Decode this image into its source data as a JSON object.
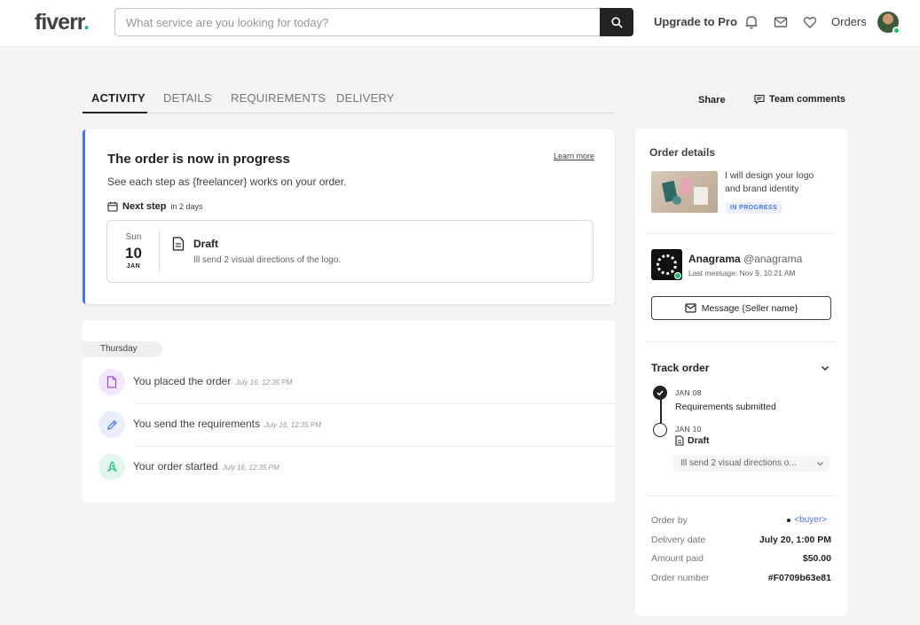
{
  "header": {
    "logo": "fiverr",
    "logo_dot": ".",
    "search_placeholder": "What service are you looking for today?",
    "upgrade_label": "Upgrade to Pro",
    "orders_label": "Orders",
    "icons": [
      "search-icon",
      "bell-icon",
      "mail-icon",
      "heart-icon"
    ]
  },
  "tabs": [
    {
      "label": "ACTIVITY",
      "active": true
    },
    {
      "label": "DETAILS",
      "active": false
    },
    {
      "label": "REQUIREMENTS",
      "active": false
    },
    {
      "label": "DELIVERY",
      "active": false
    }
  ],
  "actions": {
    "share_label": "Share",
    "team_comments_label": "Team comments"
  },
  "progress": {
    "title": "The order is now in progress",
    "learn_more": "Learn more",
    "subtitle": "See each step as {freelancer} works on your order.",
    "next_step_label": "Next step",
    "next_step_in": "in 2 days",
    "step": {
      "weekday": "Sun",
      "day": "10",
      "month": "JAN",
      "title": "Draft",
      "description": "Ill send 2 visual directions of the logo."
    }
  },
  "activity": {
    "day_label": "Thursday",
    "items": [
      {
        "text": "You placed the order",
        "time": "July 16, 12:35 PM",
        "icon": "file-icon",
        "color": "#f3e8fb"
      },
      {
        "text": "You send the requirements",
        "time": "July 16, 12:35 PM",
        "icon": "pencil-icon",
        "color": "#e8eefb"
      },
      {
        "text": "Your order started",
        "time": "July 16, 12:35 PM",
        "icon": "rocket-icon",
        "color": "#e3f6ec"
      }
    ]
  },
  "sidebar": {
    "title": "Order details",
    "gig_title": "I will design your logo and brand identity",
    "status": "IN PROGRESS",
    "seller": {
      "name": "Anagrama",
      "handle": "@anagrama",
      "last_message": "Last message: Nov 9, 10:21 AM"
    },
    "message_button": "Message {Seller name}",
    "track": {
      "title": "Track order",
      "steps": [
        {
          "date": "JAN 08",
          "label": "Requirements submitted"
        },
        {
          "date": "JAN 10",
          "label": "Draft",
          "detail": "Ill send 2 visual directions o..."
        }
      ]
    },
    "summary": {
      "order_by_label": "Order by",
      "order_by_value": "<buyer>",
      "delivery_label": "Delivery date",
      "delivery_value": "July 20, 1:00 PM",
      "amount_label": "Amount paid",
      "amount_value": "$50.00",
      "number_label": "Order number",
      "number_value": "#F0709b63e81"
    }
  },
  "colors": {
    "brand_green": "#1dbf73",
    "accent_blue": "#4a73e8",
    "dark": "#222325"
  }
}
